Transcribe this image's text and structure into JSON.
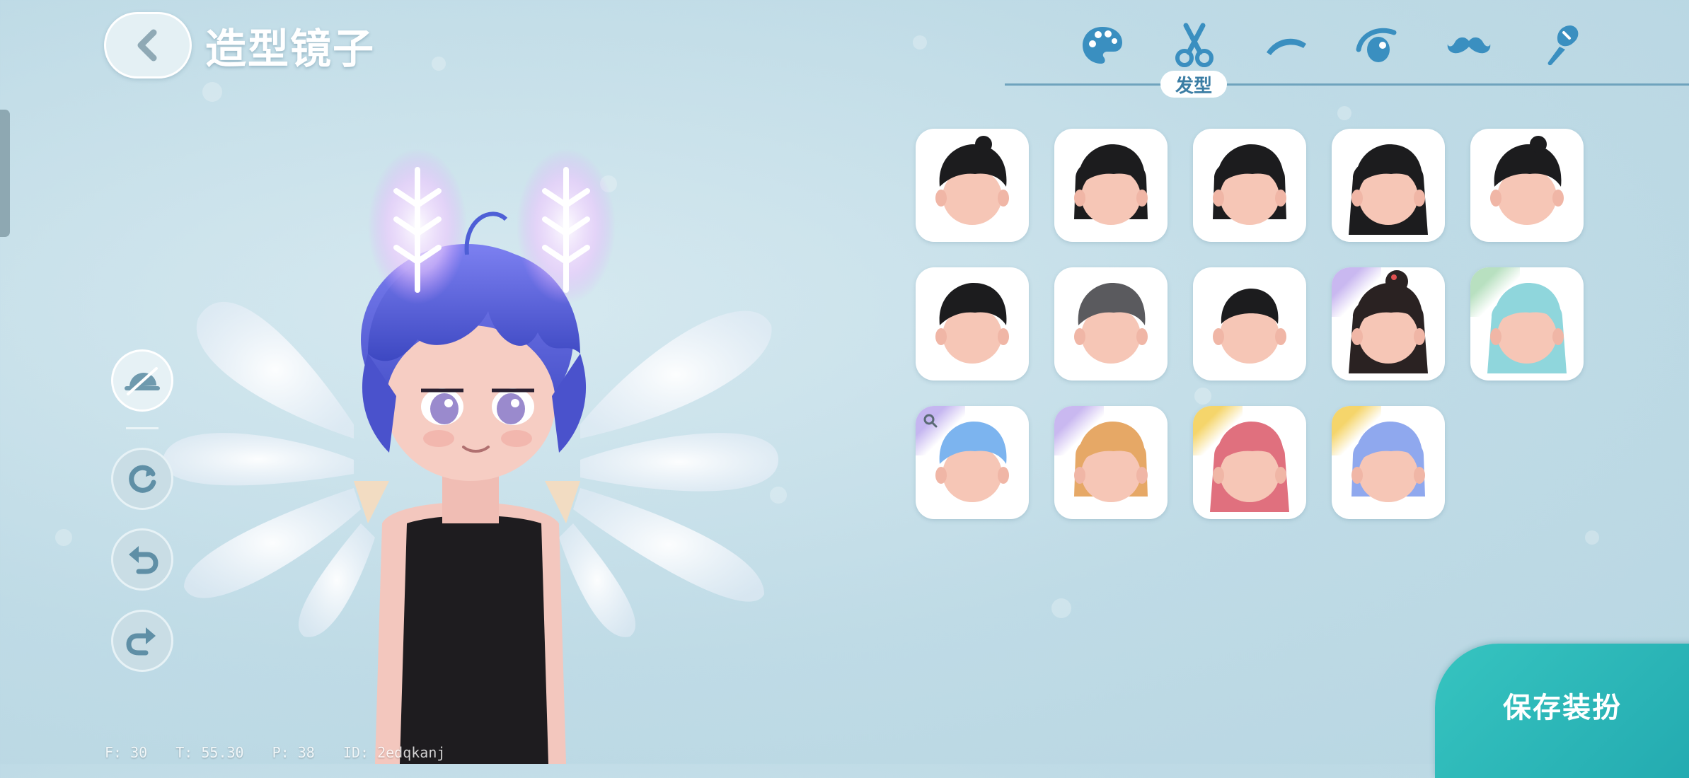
{
  "header": {
    "title": "造型镜子"
  },
  "tabs": {
    "items": [
      {
        "icon": "palette-icon"
      },
      {
        "icon": "scissors-icon"
      },
      {
        "icon": "eyebrow-icon"
      },
      {
        "icon": "eye-icon"
      },
      {
        "icon": "mustache-icon"
      },
      {
        "icon": "brush-icon"
      }
    ],
    "active_label": "发型"
  },
  "hairstyles": {
    "items": [
      {
        "hair_color": "#1c1c1e",
        "style": "short-tuft"
      },
      {
        "hair_color": "#1c1c1e",
        "style": "bob-bangs"
      },
      {
        "hair_color": "#1c1c1e",
        "style": "medium-bangs"
      },
      {
        "hair_color": "#1c1c1e",
        "style": "long-straight"
      },
      {
        "hair_color": "#1c1c1e",
        "style": "ponytail-up"
      },
      {
        "hair_color": "#1c1c1e",
        "style": "short-messy"
      },
      {
        "hair_color": "#5a5a5e",
        "style": "gray-gradient"
      },
      {
        "hair_color": "#1c1c1e",
        "style": "buzz-cut"
      },
      {
        "hair_color": "#2a2222",
        "style": "bun-long",
        "rare": "#c9b8f0"
      },
      {
        "hair_color": "#8fd6dc",
        "style": "cyan-long",
        "rare": "#b8e0c0"
      },
      {
        "hair_color": "#7cb4ef",
        "style": "blue-fluffy",
        "rare": "#c5b6f0",
        "zoom": true
      },
      {
        "hair_color": "#e6a866",
        "style": "blond-bob",
        "rare": "#c9b8f0"
      },
      {
        "hair_color": "#e0707e",
        "style": "pink-wavy",
        "rare": "#f5d56b"
      },
      {
        "hair_color": "#8fa8ee",
        "style": "blue-twin",
        "rare": "#f5d56b"
      }
    ]
  },
  "save_button": {
    "label": "保存装扮"
  },
  "debug": {
    "fps": "F: 30",
    "time": "T: 55.30",
    "ping": "P: 38",
    "id": "ID: 2edqkanj"
  },
  "colors": {
    "accent": "#2bb5b5",
    "tab_icon": "#3a8fc0",
    "hero_hair": "#4e5fd6",
    "shirt": "#1e1c1f"
  }
}
